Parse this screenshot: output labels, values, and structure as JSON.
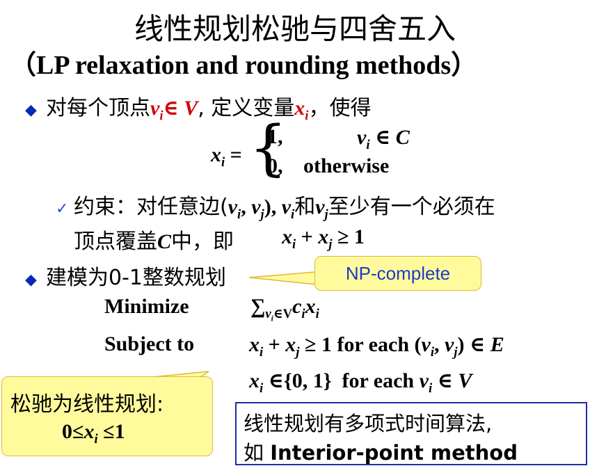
{
  "title": "线性规划松驰与四舍五入",
  "subtitle": "（LP relaxation and rounding methods）",
  "bullet1": {
    "pre": "对每个顶点",
    "v_i": "v",
    "i_sub": "i",
    "in_v": "∈ V",
    "mid": ", 定义变量",
    "x_i": "x",
    "xi_sub": "i",
    "post": "，使得"
  },
  "cases": {
    "lhs": "x",
    "lhs_sub": "i",
    "eq": " =",
    "row1_val": "1,",
    "row1_cond_v": "v",
    "row1_cond_sub": "i",
    "row1_cond_rest": " ∈ C",
    "row2_val": "0,",
    "row2_cond": "otherwise"
  },
  "constraint": {
    "line1_pre": "约束：对任意边(",
    "vi": "v",
    "vi_sub": "i",
    "comma": ", ",
    "vj": "v",
    "vj_sub": "j",
    "close": "), ",
    "vi2": "v",
    "vi2_sub": "i",
    "he": "和",
    "vj2": "v",
    "vj2_sub": "j",
    "line1_post": "至少有一个必须在",
    "line2_pre": "顶点覆盖",
    "c": "C",
    "line2_mid": "中，即",
    "xi": "x",
    "xi_sub": "i",
    "plus": " + ",
    "xj": "x",
    "xj_sub": "j",
    "ge": " ≥ 1"
  },
  "bullet2": {
    "text": "建模为0-1整数规划"
  },
  "np_callout": "NP-complete",
  "ilp": {
    "minimize_label": "Minimize",
    "sum": "∑",
    "sum_sub_v": "v",
    "sum_sub_i": "i",
    "sum_sub_rest": "∈V",
    "c": "c",
    "c_sub": "i",
    "x": "x",
    "x_sub": "i",
    "subject_label": "Subject to",
    "s1_x": "x",
    "s1_xsub": "i",
    "s1_plus": " + ",
    "s1_x2": "x",
    "s1_x2sub": "j",
    "s1_rest": " ≥ 1 for each (",
    "s1_v": "v",
    "s1_vsub": "i",
    "s1_comma": ", ",
    "s1_v2": "v",
    "s1_v2sub": "j",
    "s1_close": ") ∈ ",
    "s1_e": "E",
    "s2_x": "x",
    "s2_xsub": "i",
    "s2_set": " ∈{0, 1}  for each ",
    "s2_v": "v",
    "s2_vsub": "i",
    "s2_in": " ∈ ",
    "s2_V": "V"
  },
  "relax_callout": {
    "line1": "松驰为线性规划:",
    "pre": "0≤",
    "x": "x",
    "x_sub": "i",
    "post": " ≤1"
  },
  "note_box": {
    "line1": "线性规划有多项式时间算法,",
    "line2_pre": "如 ",
    "line2_bold": "Interior-point method"
  },
  "colors": {
    "accent_red": "#d10000",
    "bullet_blue": "#0a28b4",
    "callout_fill": "#fffb9c",
    "callout_text_blue": "#1c38c9",
    "box_border": "#1c2ea8"
  }
}
